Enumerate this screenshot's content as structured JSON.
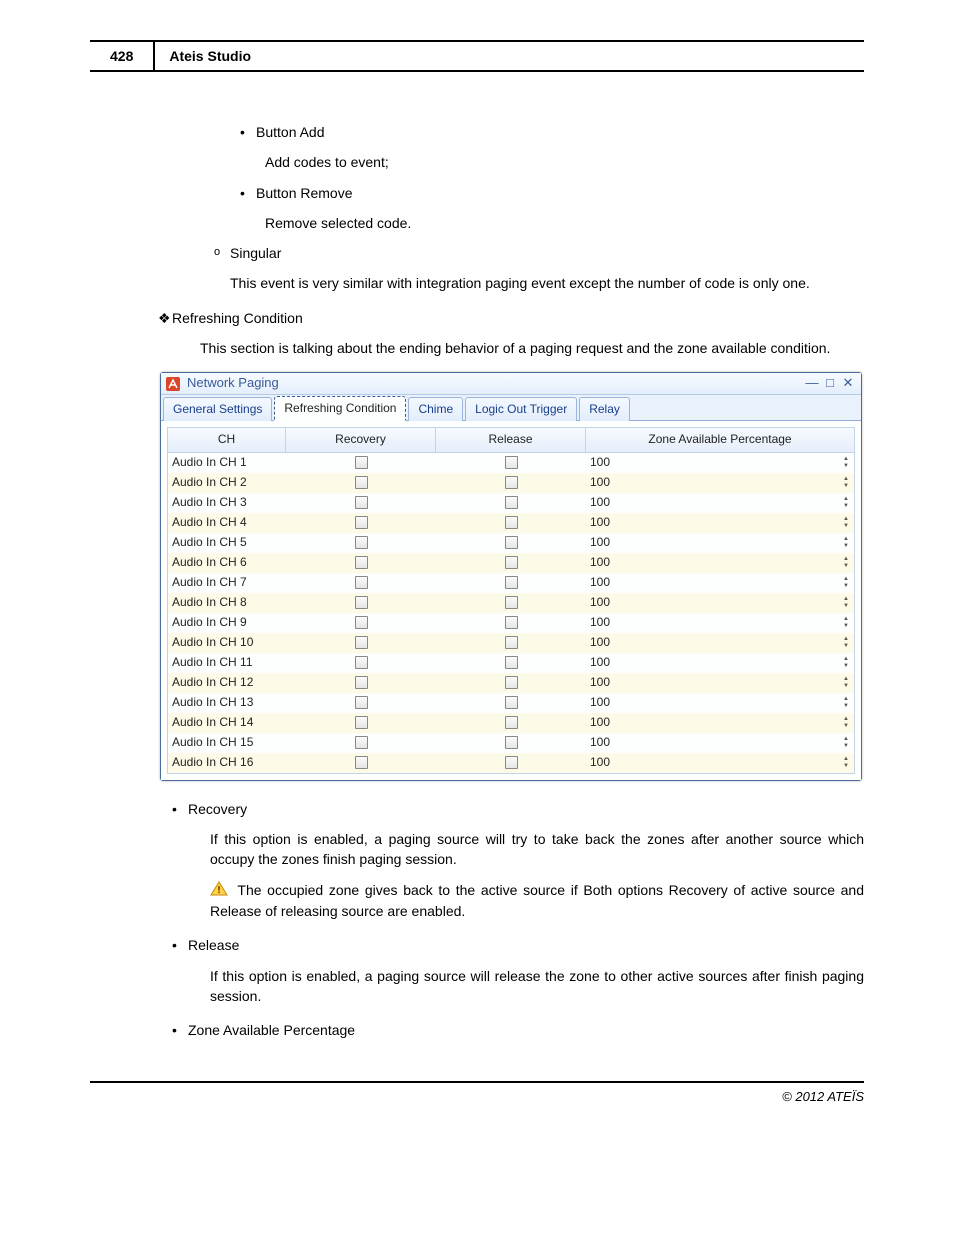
{
  "page": {
    "number": "428",
    "title": "Ateis Studio",
    "copyright": "© 2012 ATEÏS"
  },
  "doc": {
    "button_add_label": "Button Add",
    "button_add_desc": "Add codes to event;",
    "button_remove_label": "Button Remove",
    "button_remove_desc": "Remove selected code.",
    "singular_label": "Singular",
    "singular_desc": "This event is very similar with integration paging event except the number of code is only one.",
    "refreshing_label": "Refreshing Condition",
    "refreshing_desc": "This section is talking about the ending behavior of a paging request and the zone available condition.",
    "recovery_label": "Recovery",
    "recovery_desc": "If this option is enabled, a paging source will try to take back the zones after another source which occupy the zones finish paging session.",
    "recovery_warn": " The occupied zone gives back to the active source if Both options Recovery of active source and Release of releasing source are enabled.",
    "release_label": "Release",
    "release_desc": "If this option is enabled, a paging source will release the zone to other active sources after finish paging session.",
    "zone_avail_label": "Zone Available Percentage"
  },
  "window": {
    "title": "Network Paging",
    "tabs": [
      "General Settings",
      "Refreshing Condition",
      "Chime",
      "Logic Out Trigger",
      "Relay"
    ],
    "active_tab": 1,
    "headers": {
      "ch": "CH",
      "recovery": "Recovery",
      "release": "Release",
      "zone": "Zone Available Percentage"
    },
    "rows": [
      {
        "ch": "Audio In CH 1",
        "recovery": false,
        "release": false,
        "zone": "100"
      },
      {
        "ch": "Audio In CH 2",
        "recovery": false,
        "release": false,
        "zone": "100"
      },
      {
        "ch": "Audio In CH 3",
        "recovery": false,
        "release": false,
        "zone": "100"
      },
      {
        "ch": "Audio In CH 4",
        "recovery": false,
        "release": false,
        "zone": "100"
      },
      {
        "ch": "Audio In CH 5",
        "recovery": false,
        "release": false,
        "zone": "100"
      },
      {
        "ch": "Audio In CH 6",
        "recovery": false,
        "release": false,
        "zone": "100"
      },
      {
        "ch": "Audio In CH 7",
        "recovery": false,
        "release": false,
        "zone": "100"
      },
      {
        "ch": "Audio In CH 8",
        "recovery": false,
        "release": false,
        "zone": "100"
      },
      {
        "ch": "Audio In CH 9",
        "recovery": false,
        "release": false,
        "zone": "100"
      },
      {
        "ch": "Audio In CH 10",
        "recovery": false,
        "release": false,
        "zone": "100"
      },
      {
        "ch": "Audio In CH 11",
        "recovery": false,
        "release": false,
        "zone": "100"
      },
      {
        "ch": "Audio In CH 12",
        "recovery": false,
        "release": false,
        "zone": "100"
      },
      {
        "ch": "Audio In CH 13",
        "recovery": false,
        "release": false,
        "zone": "100"
      },
      {
        "ch": "Audio In CH 14",
        "recovery": false,
        "release": false,
        "zone": "100"
      },
      {
        "ch": "Audio In CH 15",
        "recovery": false,
        "release": false,
        "zone": "100"
      },
      {
        "ch": "Audio In CH 16",
        "recovery": false,
        "release": false,
        "zone": "100"
      }
    ]
  }
}
